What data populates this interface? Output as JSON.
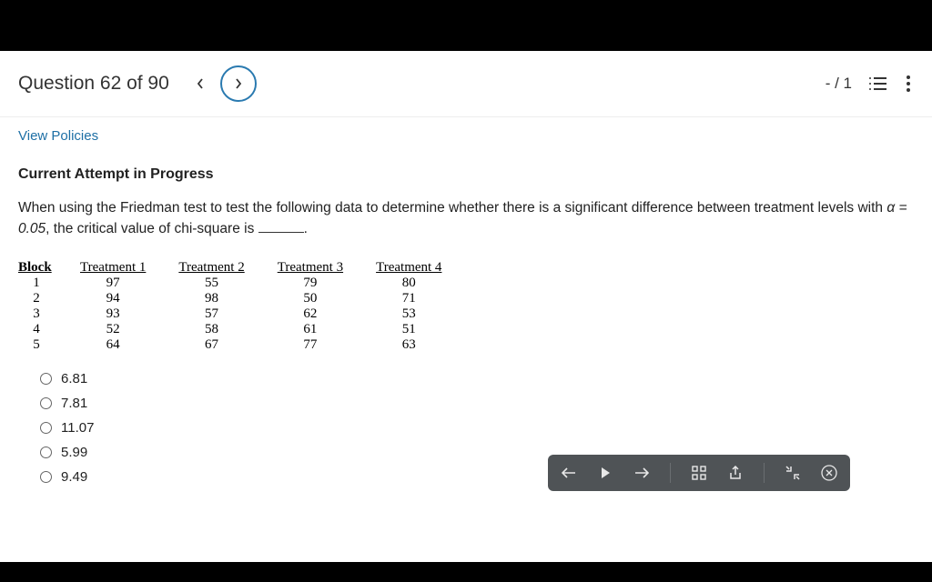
{
  "header": {
    "question_label": "Question 62 of 90",
    "score": "- / 1"
  },
  "links": {
    "view_policies": "View Policies"
  },
  "section": {
    "title": "Current Attempt in Progress"
  },
  "question": {
    "text_before": "When using the Friedman test to test the following data to determine whether there is a significant difference between treatment levels with ",
    "alpha_expr": "α = 0.05",
    "text_after": ", the critical value of chi-square is "
  },
  "table": {
    "headers": [
      "Block",
      "Treatment 1",
      "Treatment 2",
      "Treatment 3",
      "Treatment 4"
    ],
    "rows": [
      [
        "1",
        "97",
        "55",
        "79",
        "80"
      ],
      [
        "2",
        "94",
        "98",
        "50",
        "71"
      ],
      [
        "3",
        "93",
        "57",
        "62",
        "53"
      ],
      [
        "4",
        "52",
        "58",
        "61",
        "51"
      ],
      [
        "5",
        "64",
        "67",
        "77",
        "63"
      ]
    ]
  },
  "options": [
    "6.81",
    "7.81",
    "11.07",
    "5.99",
    "9.49"
  ],
  "toolbar_icons": {
    "back": "back-icon",
    "play": "play-icon",
    "forward": "forward-icon",
    "grid": "grid-icon",
    "share": "share-icon",
    "collapse": "collapse-icon",
    "close": "close-circle-icon"
  }
}
